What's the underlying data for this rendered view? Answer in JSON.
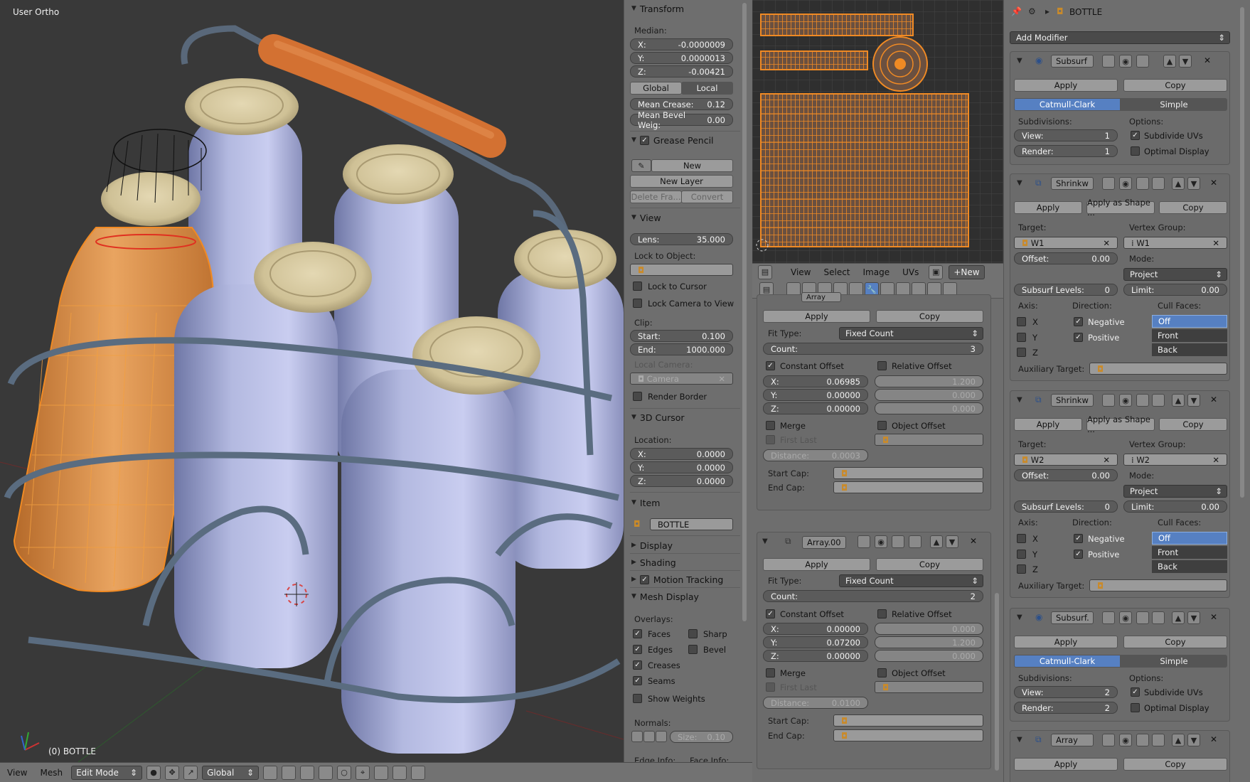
{
  "viewport": {
    "view_label": "User Ortho",
    "object_label": "(0) BOTTLE"
  },
  "header3d": {
    "view_menu": "View",
    "mesh_menu": "Mesh",
    "mode": "Edit Mode",
    "orientation": "Global"
  },
  "npanel": {
    "transform": {
      "title": "Transform",
      "median_label": "Median:",
      "x": "X:",
      "x_val": "-0.0000009",
      "y": "Y:",
      "y_val": "0.0000013",
      "z": "Z:",
      "z_val": "-0.00421",
      "global": "Global",
      "local": "Local",
      "crease": "Mean Crease:",
      "crease_val": "0.12",
      "bevel": "Mean Bevel Weig:",
      "bevel_val": "0.00"
    },
    "grease": {
      "title": "Grease Pencil",
      "new": "New",
      "new_layer": "New Layer",
      "delete_frame": "Delete Fra...",
      "convert": "Convert"
    },
    "view": {
      "title": "View",
      "lens": "Lens:",
      "lens_val": "35.000",
      "lock_obj": "Lock to Object:",
      "lock_cursor": "Lock to Cursor",
      "lock_camera": "Lock Camera to View",
      "clip": "Clip:",
      "start": "Start:",
      "start_val": "0.100",
      "end": "End:",
      "end_val": "1000.000",
      "local_camera": "Local Camera:",
      "camera": "Camera",
      "render_border": "Render Border"
    },
    "cursor": {
      "title": "3D Cursor",
      "location": "Location:",
      "x": "X:",
      "x_val": "0.0000",
      "y": "Y:",
      "y_val": "0.0000",
      "z": "Z:",
      "z_val": "0.0000"
    },
    "item": {
      "title": "Item",
      "name": "BOTTLE"
    },
    "collapsed": [
      "Display",
      "Shading",
      "Motion Tracking"
    ],
    "mesh_display": {
      "title": "Mesh Display",
      "overlays": "Overlays:",
      "faces": "Faces",
      "sharp": "Sharp",
      "edges": "Edges",
      "bevel": "Bevel",
      "creases": "Creases",
      "seams": "Seams",
      "show_weights": "Show Weights",
      "normals": "Normals:",
      "size": "Size:",
      "size_val": "0.10",
      "edge_info": "Edge Info:",
      "face_info": "Face Info:"
    }
  },
  "uvheader": {
    "view": "View",
    "select": "Select",
    "image": "Image",
    "uvs": "UVs",
    "new": "New"
  },
  "modmid": {
    "array1": {
      "name": "Array",
      "apply": "Apply",
      "copy": "Copy",
      "fit_type": "Fit Type:",
      "fit_val": "Fixed Count",
      "count": "Count:",
      "count_val": "3",
      "const_offset": "Constant Offset",
      "rel_offset": "Relative Offset",
      "cx": "X:",
      "cx_val": "0.06985",
      "cy": "Y:",
      "cy_val": "0.00000",
      "cz": "Z:",
      "cz_val": "0.00000",
      "rx_val": "1.200",
      "ry_val": "0.000",
      "rz_val": "0.000",
      "merge": "Merge",
      "obj_offset": "Object Offset",
      "first_last": "First Last",
      "distance": "Distance:",
      "distance_val": "0.0003",
      "start_cap": "Start Cap:",
      "end_cap": "End Cap:"
    },
    "array2": {
      "name": "Array.00",
      "apply": "Apply",
      "copy": "Copy",
      "fit_type": "Fit Type:",
      "fit_val": "Fixed Count",
      "count": "Count:",
      "count_val": "2",
      "const_offset": "Constant Offset",
      "rel_offset": "Relative Offset",
      "cx": "X:",
      "cx_val": "0.00000",
      "cy": "Y:",
      "cy_val": "0.07200",
      "cz": "Z:",
      "cz_val": "0.00000",
      "rx_val": "0.000",
      "ry_val": "1.200",
      "rz_val": "0.000",
      "merge": "Merge",
      "obj_offset": "Object Offset",
      "first_last": "First Last",
      "distance": "Distance:",
      "distance_val": "0.0100",
      "start_cap": "Start Cap:",
      "end_cap": "End Cap:"
    }
  },
  "props": {
    "object_name": "BOTTLE",
    "add_modifier": "Add Modifier",
    "subsurf1": {
      "name": "Subsurf",
      "apply": "Apply",
      "copy": "Copy",
      "catmull": "Catmull-Clark",
      "simple": "Simple",
      "subdivisions": "Subdivisions:",
      "options": "Options:",
      "view": "View:",
      "view_val": "1",
      "render": "Render:",
      "render_val": "1",
      "subdivide_uvs": "Subdivide UVs",
      "optimal": "Optimal Display"
    },
    "shrink1": {
      "name": "Shrinkw",
      "apply": "Apply",
      "apply_shape": "Apply as Shape ...",
      "copy": "Copy",
      "target": "Target:",
      "vgroup": "Vertex Group:",
      "target_val": "W1",
      "vgroup_val": "W1",
      "offset": "Offset:",
      "offset_val": "0.00",
      "mode": "Mode:",
      "mode_val": "Project",
      "subsurf_levels": "Subsurf Levels:",
      "subsurf_val": "0",
      "limit": "Limit:",
      "limit_val": "0.00",
      "axis": "Axis:",
      "direction": "Direction:",
      "cull": "Cull Faces:",
      "x": "X",
      "y": "Y",
      "z": "Z",
      "negative": "Negative",
      "positive": "Positive",
      "off": "Off",
      "front": "Front",
      "back": "Back",
      "aux": "Auxiliary Target:"
    },
    "shrink2": {
      "name": "Shrinkw",
      "apply": "Apply",
      "apply_shape": "Apply as Shape ...",
      "copy": "Copy",
      "target": "Target:",
      "vgroup": "Vertex Group:",
      "target_val": "W2",
      "vgroup_val": "W2",
      "offset": "Offset:",
      "offset_val": "0.00",
      "mode": "Mode:",
      "mode_val": "Project",
      "subsurf_levels": "Subsurf Levels:",
      "subsurf_val": "0",
      "limit": "Limit:",
      "limit_val": "0.00",
      "axis": "Axis:",
      "direction": "Direction:",
      "cull": "Cull Faces:",
      "x": "X",
      "y": "Y",
      "z": "Z",
      "negative": "Negative",
      "positive": "Positive",
      "off": "Off",
      "front": "Front",
      "back": "Back",
      "aux": "Auxiliary Target:"
    },
    "subsurf2": {
      "name": "Subsurf.",
      "apply": "Apply",
      "copy": "Copy",
      "catmull": "Catmull-Clark",
      "simple": "Simple",
      "subdivisions": "Subdivisions:",
      "options": "Options:",
      "view": "View:",
      "view_val": "2",
      "render": "Render:",
      "render_val": "2",
      "subdivide_uvs": "Subdivide UVs",
      "optimal": "Optimal Display"
    },
    "array3": {
      "name": "Array",
      "apply": "Apply",
      "copy": "Copy"
    }
  },
  "colors": {
    "accent": "#5680c2",
    "selection": "#f08a24",
    "handle": "#c9632c"
  }
}
